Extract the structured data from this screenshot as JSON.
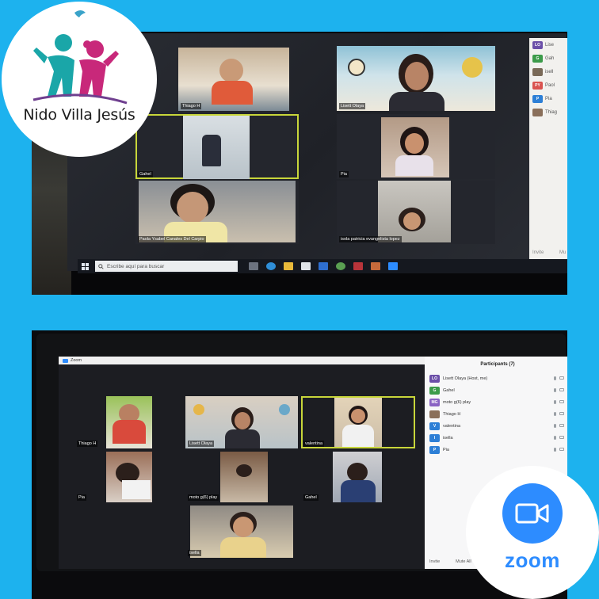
{
  "logo": {
    "name": "Nido Villa Jesús"
  },
  "top_meeting": {
    "tiles": [
      {
        "label": "Thiago H",
        "active": false
      },
      {
        "label": "Lisett Olaya",
        "active": false
      },
      {
        "label": "Gahel",
        "active": true
      },
      {
        "label": "Pia",
        "active": false
      },
      {
        "label": "Paola Ysabel Canales Del Carpio",
        "active": false
      },
      {
        "label": "isola patricia evangelista lopez",
        "active": false
      }
    ],
    "participants": [
      {
        "initials": "LO",
        "name": "Lise",
        "color": "#6b4fa8"
      },
      {
        "initials": "G",
        "name": "Gah",
        "color": "#3c9b4a"
      },
      {
        "initials": "",
        "name": "isell",
        "color": "#7a6a58"
      },
      {
        "initials": "PY",
        "name": "Paol",
        "color": "#d9534f"
      },
      {
        "initials": "P",
        "name": "Pia",
        "color": "#2d7fd6"
      },
      {
        "initials": "",
        "name": "Thiag",
        "color": "#8a6f5a"
      }
    ],
    "footer": {
      "left": "Invite",
      "right": "Mu"
    },
    "taskbar": {
      "search_placeholder": "Escribe aquí para buscar"
    }
  },
  "bottom_meeting": {
    "window_title": "Zoom",
    "tiles": [
      {
        "label": "Thiago H",
        "active": false
      },
      {
        "label": "Lisett Olaya",
        "active": false
      },
      {
        "label": "valentina",
        "active": true
      },
      {
        "label": "Pia",
        "active": false
      },
      {
        "label": "moto g(6) play",
        "active": false
      },
      {
        "label": "Gahel",
        "active": false
      },
      {
        "label": "isella",
        "active": false
      }
    ],
    "participants_title": "Participants (7)",
    "participants": [
      {
        "initials": "LO",
        "name": "Lisett Olaya (Host, me)",
        "color": "#6b4fa8"
      },
      {
        "initials": "G",
        "name": "Gahel",
        "color": "#3c9b4a"
      },
      {
        "initials": "MG",
        "name": "moto g(6) play",
        "color": "#8a63c4"
      },
      {
        "initials": "",
        "name": "Thiago H",
        "color": "#8a6f5a"
      },
      {
        "initials": "V",
        "name": "valentina",
        "color": "#2d7fd6"
      },
      {
        "initials": "I",
        "name": "isella",
        "color": "#2d7fd6"
      },
      {
        "initials": "P",
        "name": "Pia",
        "color": "#2d7fd6"
      }
    ],
    "footer": {
      "invite": "Invite",
      "mute_all": "Mute All"
    }
  },
  "zoom_badge": {
    "word": "zoom",
    "color": "#2d8cff"
  }
}
